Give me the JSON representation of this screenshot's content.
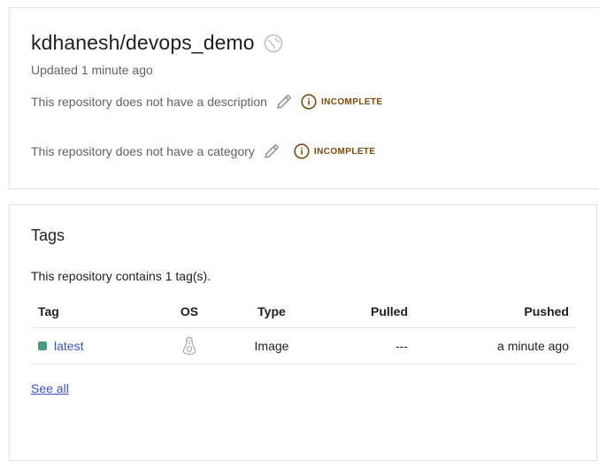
{
  "repository": {
    "title": "kdhanesh/devops_demo",
    "updated": "Updated 1 minute ago",
    "icon": "globe-icon",
    "description": {
      "text": "This repository does not have a description",
      "badge": "INCOMPLETE"
    },
    "category": {
      "text": "This repository does not have a category",
      "badge": "INCOMPLETE"
    }
  },
  "tags": {
    "heading": "Tags",
    "count_text": "This repository contains 1 tag(s).",
    "columns": [
      "Tag",
      "OS",
      "Type",
      "Pulled",
      "Pushed"
    ],
    "rows": [
      {
        "tag": "latest",
        "os": "linux-icon",
        "type": "Image",
        "pulled": "---",
        "pushed": "a minute ago"
      }
    ],
    "see_all": "See all"
  },
  "colors": {
    "link": "#3b56c9",
    "badge": "#7a4b0c",
    "tag_dot": "#4a9a82",
    "border": "#e1e2e6"
  }
}
